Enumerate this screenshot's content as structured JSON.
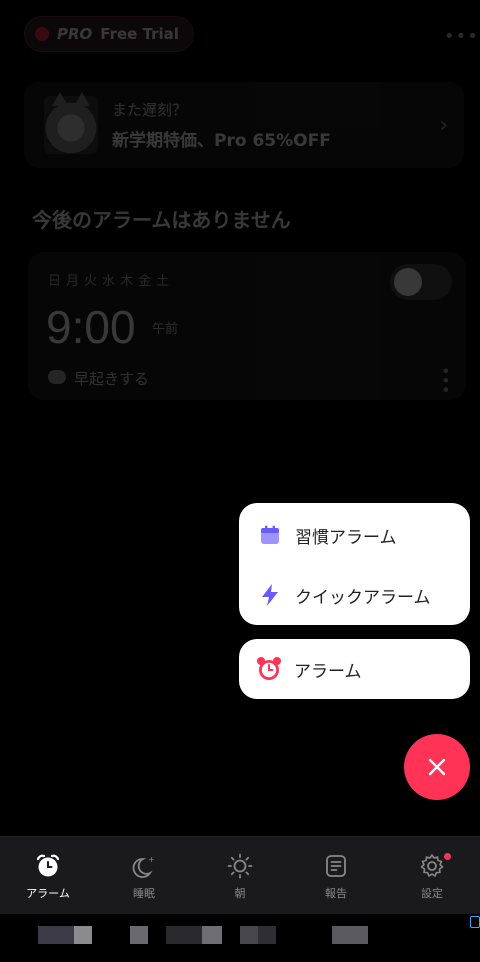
{
  "header": {
    "pro_badge": "PRO",
    "pro_label": "Free Trial",
    "more_icon": "more-horizontal-icon"
  },
  "promo": {
    "line1": "また遅刻？",
    "line2": "新学期特価、Pro 65%OFF",
    "chevron": "›"
  },
  "main": {
    "no_alarm_title": "今後のアラームはありません"
  },
  "alarm_card": {
    "weekdays": [
      "日",
      "月",
      "火",
      "水",
      "木",
      "金",
      "土"
    ],
    "time": "9:00",
    "ampm": "午前",
    "mission_label": "早起きする",
    "enabled": false
  },
  "fab_menu": {
    "items": [
      {
        "label": "習慣アラーム",
        "icon": "calendar-icon"
      },
      {
        "label": "クイックアラーム",
        "icon": "lightning-icon"
      }
    ],
    "alarm": {
      "label": "アラーム",
      "icon": "alarm-clock-icon"
    },
    "close_icon": "close-icon"
  },
  "bottom_nav": {
    "items": [
      {
        "label": "アラーム",
        "icon": "alarm-clock-icon",
        "active": true
      },
      {
        "label": "睡眠",
        "icon": "moon-icon",
        "active": false
      },
      {
        "label": "朝",
        "icon": "sun-icon",
        "active": false
      },
      {
        "label": "報告",
        "icon": "report-icon",
        "active": false
      },
      {
        "label": "設定",
        "icon": "gear-icon",
        "active": false,
        "badge": true
      }
    ]
  },
  "colors": {
    "accent": "#ff3355",
    "menu_icon_purple": "#6a5af9",
    "background": "#000000"
  }
}
